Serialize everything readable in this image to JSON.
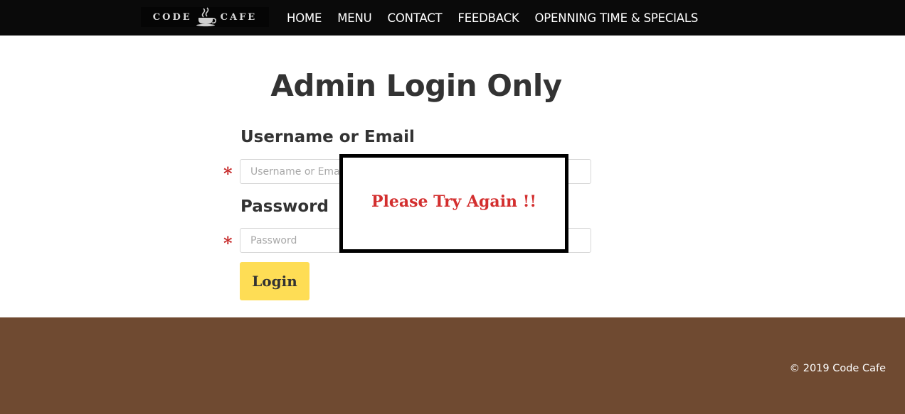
{
  "brand": {
    "logo_left": "CODE",
    "logo_right": "CAFE",
    "logo_icon": "coffee-cup-icon"
  },
  "nav": {
    "items": [
      {
        "label": "HOME"
      },
      {
        "label": "MENU"
      },
      {
        "label": "CONTACT"
      },
      {
        "label": "FEEDBACK"
      },
      {
        "label": "OPENNING TIME & SPECIALS"
      }
    ]
  },
  "page": {
    "title": "Admin Login Only"
  },
  "form": {
    "username_label": "Username or Email",
    "username_placeholder": "Username or Email",
    "username_value": "",
    "password_label": "Password",
    "password_placeholder": "Password",
    "password_value": "",
    "required_marker": "*",
    "login_label": "Login"
  },
  "dialog": {
    "message": "Please Try Again !!"
  },
  "footer": {
    "copyright": "© 2019 Code Cafe"
  },
  "colors": {
    "navbar": "#0a0a0a",
    "footer": "#6f4a31",
    "button": "#fedd55",
    "required": "#c62828",
    "error_text": "#d32f2f"
  }
}
